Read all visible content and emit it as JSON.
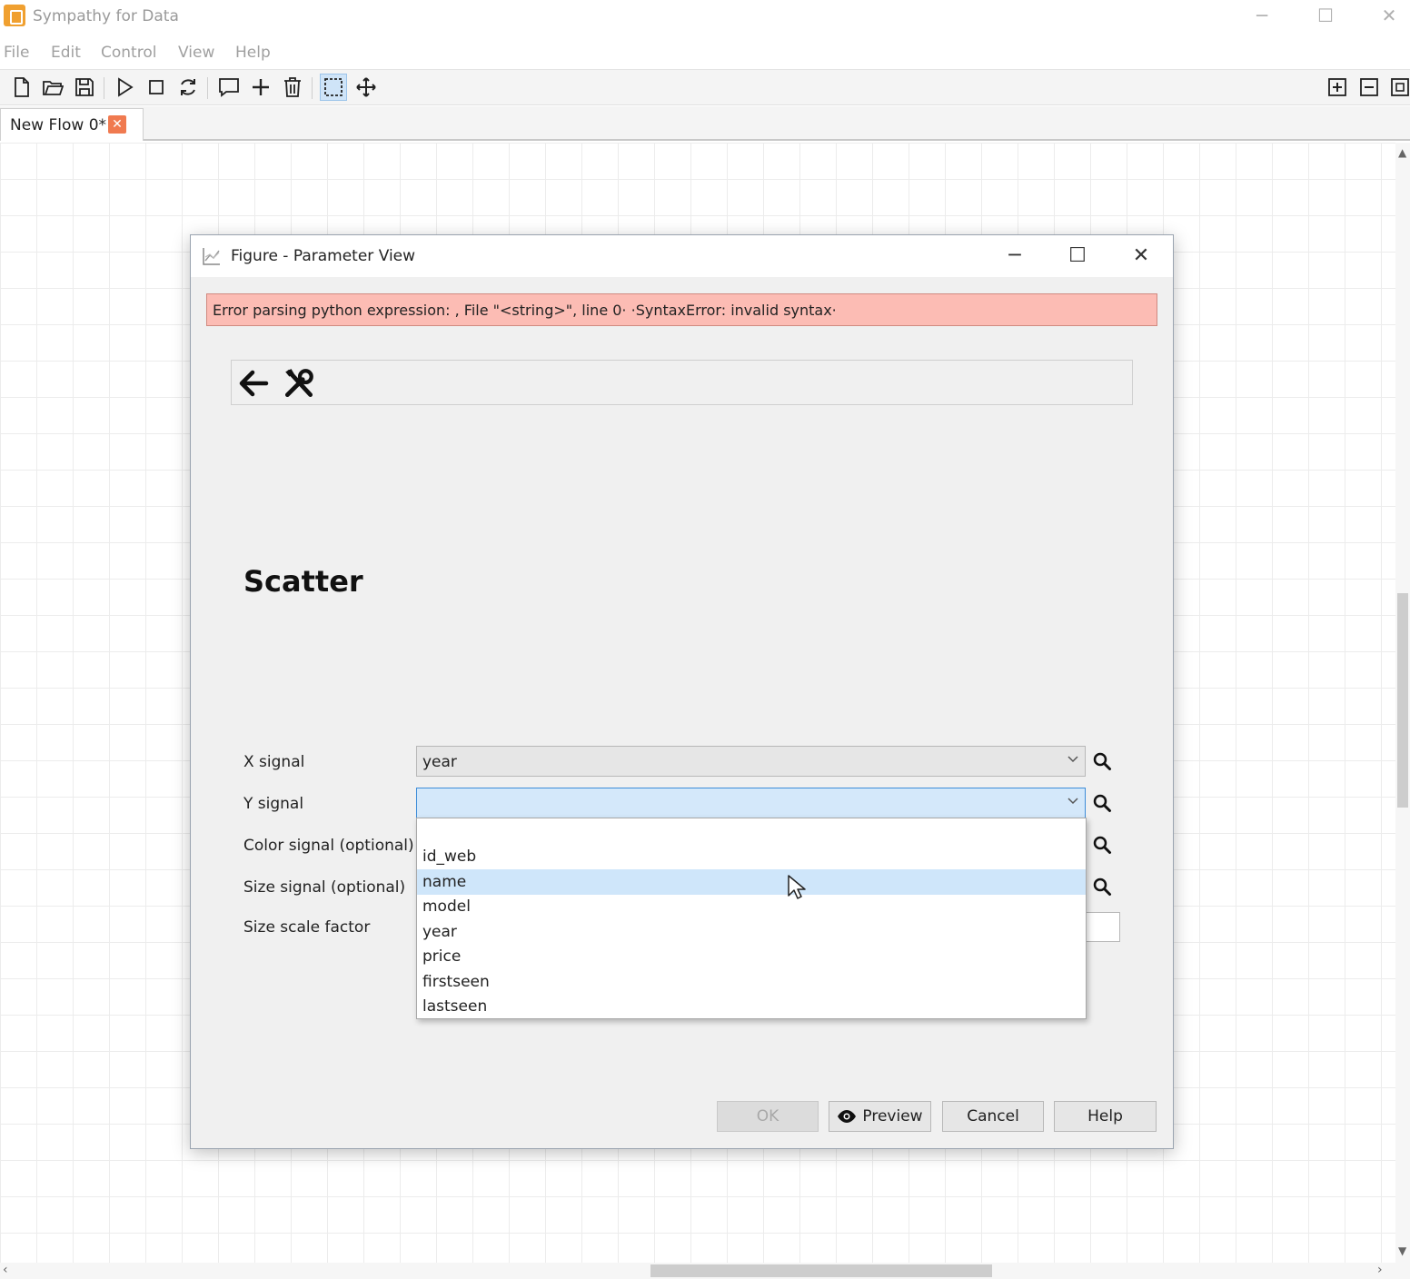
{
  "app": {
    "title": "Sympathy for Data",
    "icon": "sympathy-logo-icon"
  },
  "window_controls": {
    "minimize": "─",
    "maximize": "☐",
    "close": "✕"
  },
  "menu": {
    "items": [
      "File",
      "Edit",
      "Control",
      "View",
      "Help"
    ]
  },
  "toolbar": {
    "icons": [
      "new-file-icon",
      "open-folder-icon",
      "save-icon",
      "play-icon",
      "stop-icon",
      "reload-icon",
      "comment-icon",
      "add-icon",
      "delete-icon",
      "select-icon",
      "move-icon",
      "zoom-in-icon",
      "zoom-out-icon",
      "fit-icon"
    ],
    "active_tool": "select-icon"
  },
  "tabs": [
    {
      "label": "New Flow 0*",
      "close": "✕"
    }
  ],
  "dialog": {
    "title": "Figure - Parameter View",
    "icon": "figure-chart-icon",
    "controls": {
      "minimize": "─",
      "maximize": "☐",
      "close": "✕"
    },
    "error": "Error parsing python expression: , File \"<string>\", line 0· ·SyntaxError: invalid syntax·",
    "error_color": "#fcbcb4",
    "section_title": "Scatter",
    "fields": {
      "x_signal": {
        "label": "X signal",
        "value": "year"
      },
      "y_signal": {
        "label": "Y signal",
        "value": ""
      },
      "color_signal": {
        "label": "Color signal (optional)"
      },
      "size_signal": {
        "label": "Size signal (optional)"
      },
      "size_scale": {
        "label": "Size scale factor"
      }
    },
    "dropdown": {
      "options": [
        "",
        "id_web",
        "name",
        "model",
        "year",
        "price",
        "firstseen",
        "lastseen"
      ],
      "highlighted": "name"
    },
    "buttons": {
      "ok": "OK",
      "preview": "Preview",
      "cancel": "Cancel",
      "help": "Help"
    }
  },
  "colors": {
    "focus_blue": "#3c8cd8",
    "highlight_blue": "#cfe6fa",
    "tab_close": "#f07a50"
  }
}
